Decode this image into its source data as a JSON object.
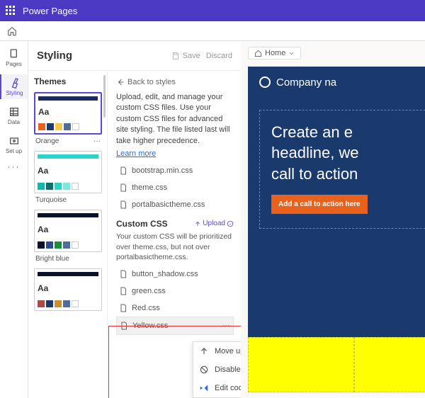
{
  "app": {
    "name": "Power Pages"
  },
  "sidenav": {
    "pages": "Pages",
    "styling": "Styling",
    "data": "Data",
    "setup": "Set up"
  },
  "styling": {
    "title": "Styling",
    "save": "Save",
    "discard": "Discard"
  },
  "themes": {
    "heading": "Themes",
    "items": [
      {
        "label": "Orange"
      },
      {
        "label": "Turquoise"
      },
      {
        "label": "Bright blue"
      },
      {
        "label": ""
      }
    ],
    "aa": "Aa"
  },
  "detail": {
    "back": "Back to styles",
    "desc": "Upload, edit, and manage your custom CSS files. Use your custom CSS files for advanced site styling. The file listed last will take higher precedence.",
    "learn": "Learn more",
    "base_files": [
      "bootstrap.min.css",
      "theme.css",
      "portalbasictheme.css"
    ],
    "custom_heading": "Custom CSS",
    "upload": "Upload",
    "desc2": "Your custom CSS will be prioritized over theme.css, but not over portalbasictheme.css.",
    "custom_files": [
      "button_shadow.css",
      "green.css",
      "Red.css",
      "Yellow.css"
    ]
  },
  "context_menu": {
    "moveup": "Move up",
    "disable": "Disable",
    "edit": "Edit code"
  },
  "preview": {
    "crumb": "Home",
    "company": "Company na",
    "headline": "Create an e\nheadline, we\ncall to action",
    "cta": "Add a call to action here"
  }
}
